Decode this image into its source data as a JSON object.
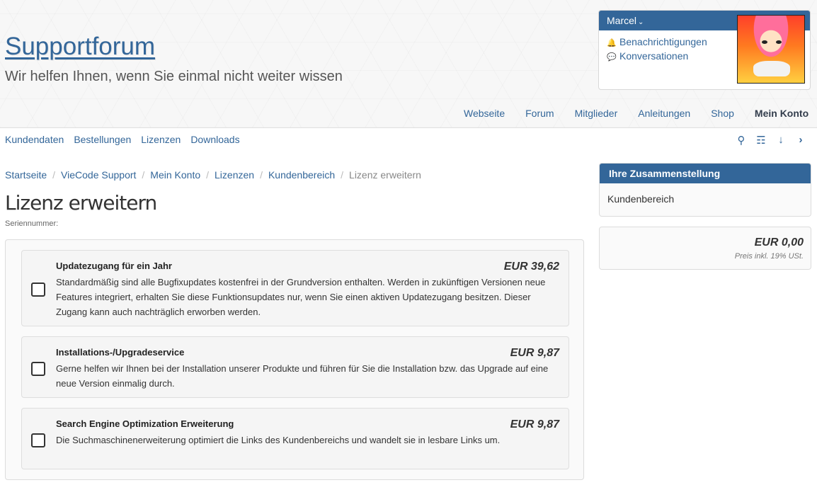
{
  "header": {
    "site_title": "Supportforum",
    "subtitle": "Wir helfen Ihnen, wenn Sie einmal nicht weiter wissen"
  },
  "userbox": {
    "username": "Marcel",
    "links": [
      {
        "label": "Benachrichtigungen",
        "icon": "bell-icon"
      },
      {
        "label": "Konversationen",
        "icon": "comments-icon"
      }
    ]
  },
  "main_nav": [
    "Webseite",
    "Forum",
    "Mitglieder",
    "Anleitungen",
    "Shop",
    "Mein Konto"
  ],
  "sub_nav": [
    "Kundendaten",
    "Bestellungen",
    "Lizenzen",
    "Downloads"
  ],
  "toolbar_icons": [
    "search-icon",
    "sitemap-icon",
    "arrow-down-icon",
    "chevron-right-icon"
  ],
  "breadcrumb": [
    "Startseite",
    "VieCode Support",
    "Mein Konto",
    "Lizenzen",
    "Kundenbereich",
    "Lizenz erweitern"
  ],
  "page": {
    "title": "Lizenz erweitern",
    "serial_label": "Seriennummer:"
  },
  "options": [
    {
      "title": "Updatezugang für ein Jahr",
      "description": "Standardmäßig sind alle Bugfixupdates kostenfrei in der Grundversion enthalten. Werden in zukünftigen Versionen neue Features integriert, erhalten Sie diese Funktionsupdates nur, wenn Sie einen aktiven Updatezugang besitzen. Dieser Zugang kann auch nachträglich erworben werden.",
      "price": "EUR 39,62",
      "checked": false
    },
    {
      "title": "Installations-/Upgradeservice",
      "description": "Gerne helfen wir Ihnen bei der Installation unserer Produkte und führen für Sie die Installation bzw. das Upgrade auf eine neue Version einmalig durch.",
      "price": "EUR 9,87",
      "checked": false
    },
    {
      "title": "Search Engine Optimization Erweiterung",
      "description": "Die Suchmaschinenerweiterung optimiert die Links des Kundenbereichs und wandelt sie in lesbare Links um.",
      "price": "EUR 9,87",
      "checked": false
    }
  ],
  "sidebar": {
    "summary_title": "Ihre Zusammenstellung",
    "summary_item": "Kundenbereich",
    "total_price": "EUR 0,00",
    "total_note": "Preis inkl. 19% USt."
  },
  "colors": {
    "accent": "#336699",
    "header_bg": "#f7f7f7"
  }
}
